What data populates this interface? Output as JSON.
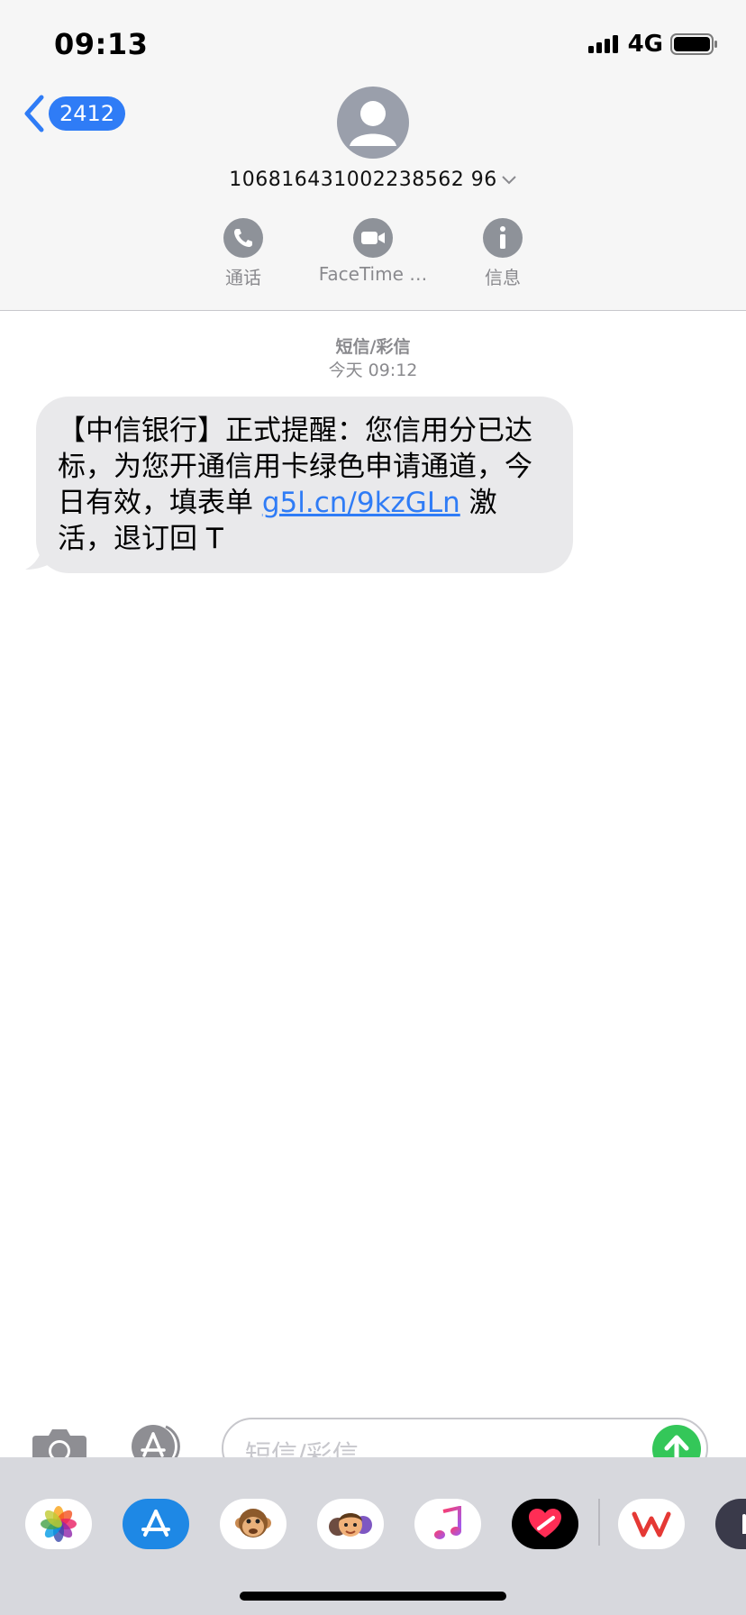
{
  "status_bar": {
    "time": "09:13",
    "network": "4G"
  },
  "header": {
    "back_badge": "2412",
    "sender": "106816431002238562 96",
    "actions": [
      {
        "label": "通话",
        "icon": "phone-icon"
      },
      {
        "label": "FaceTime …",
        "icon": "video-camera-icon"
      },
      {
        "label": "信息",
        "icon": "info-icon"
      }
    ]
  },
  "conversation": {
    "service": "短信/彩信",
    "timestamp": "今天 09:12",
    "message": {
      "text_before": "【中信银行】正式提醒：您信用分已达标，为您开通信用卡绿色申请通道，今日有效，填表单 ",
      "link": "g5l.cn/9kzGLn",
      "text_after": " 激活，退订回 T"
    }
  },
  "compose": {
    "placeholder": "短信/彩信"
  },
  "app_drawer": {
    "apps": [
      "photos-icon",
      "app-store-icon",
      "animoji-icon",
      "memoji-icon",
      "music-icon",
      "digital-touch-icon",
      "wps-icon",
      "more-apps-icon"
    ]
  },
  "colors": {
    "accent": "#2f7cf6",
    "bubble": "#e9e9eb",
    "send": "#34c759"
  }
}
